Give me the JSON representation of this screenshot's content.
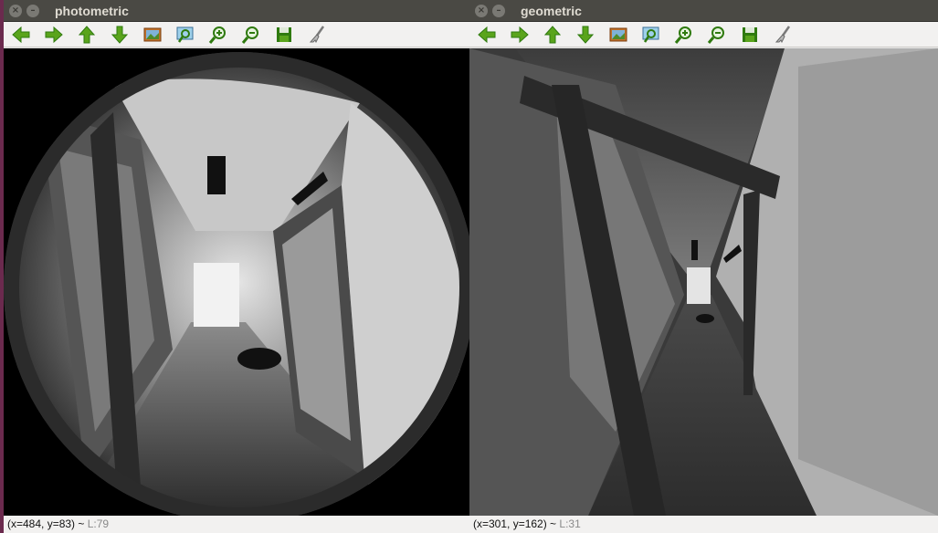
{
  "windows": {
    "left": {
      "title": "photometric",
      "status": "(x=484, y=83) ~ ",
      "level": "L:79"
    },
    "right": {
      "title": "geometric",
      "status": "(x=301, y=162) ~ ",
      "level": "L:31"
    }
  },
  "titlebar_buttons": {
    "close": "×",
    "minimize": "–"
  },
  "toolbar_icons": [
    "arrow-left-icon",
    "arrow-right-icon",
    "arrow-up-icon",
    "arrow-down-icon",
    "fit-image-icon",
    "zoom-region-icon",
    "zoom-in-icon",
    "zoom-out-icon",
    "save-icon",
    "properties-brush-icon"
  ],
  "colors": {
    "icon_green": "#5aa41c",
    "icon_dark_green": "#2f7a0f",
    "titlebar": "#4a4944",
    "desktop": "#6b2a4e"
  }
}
